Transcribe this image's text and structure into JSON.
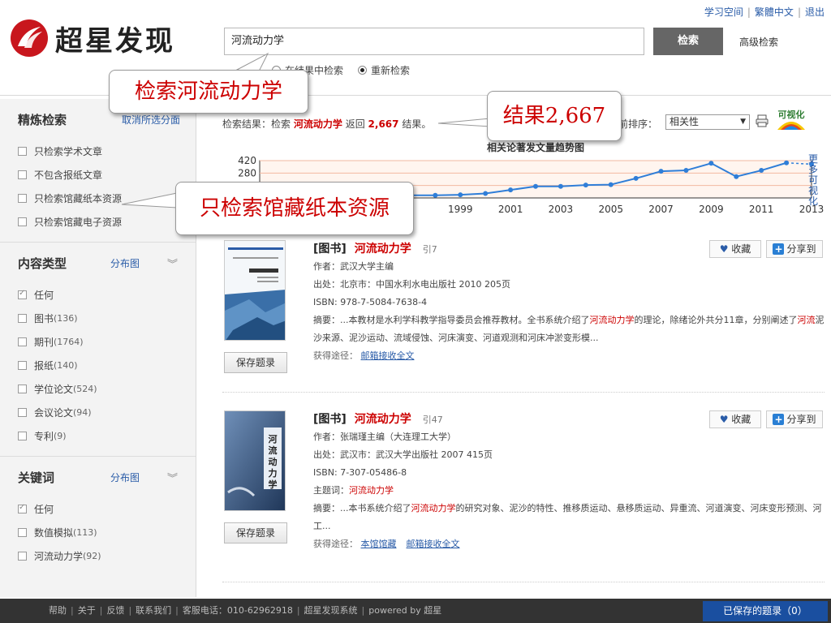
{
  "header": {
    "top_links": [
      "学习空间",
      "繁體中文",
      "退出"
    ],
    "logo_text": "超星发现",
    "search_value": "河流动力学",
    "search_button": "检索",
    "advanced_search": "高级检索",
    "search_option_1": "在结果中检索",
    "search_option_2": "重新检索"
  },
  "sidebar": {
    "refine": {
      "title": "精炼检索",
      "link": "取消所选分面",
      "items": [
        "只检索学术文章",
        "不包含报纸文章",
        "只检索馆藏纸本资源",
        "只检索馆藏电子资源"
      ]
    },
    "content_type": {
      "title": "内容类型",
      "link": "分布图",
      "items": [
        {
          "label": "任何",
          "count": ""
        },
        {
          "label": "图书",
          "count": "(136)"
        },
        {
          "label": "期刊",
          "count": "(1764)"
        },
        {
          "label": "报纸",
          "count": "(140)"
        },
        {
          "label": "学位论文",
          "count": "(524)"
        },
        {
          "label": "会议论文",
          "count": "(94)"
        },
        {
          "label": "专利",
          "count": "(9)"
        }
      ]
    },
    "keywords": {
      "title": "关键词",
      "link": "分布图",
      "items": [
        {
          "label": "任何",
          "count": ""
        },
        {
          "label": "数值模拟",
          "count": "(113)"
        },
        {
          "label": "河流动力学",
          "count": "(92)"
        }
      ]
    }
  },
  "main": {
    "result_prefix": "检索结果：检索",
    "result_keyword": "河流动力学",
    "result_mid": "返回",
    "result_count": "2,667",
    "result_suffix": "结果。",
    "sort_label": "前排序：",
    "sort_value": "相关性",
    "more_viz": "更多可视化"
  },
  "chart_data": {
    "type": "line",
    "title": "相关论著发文量趋势图",
    "x": [
      1991,
      1992,
      1993,
      1994,
      1995,
      1996,
      1997,
      1998,
      1999,
      2000,
      2001,
      2002,
      2003,
      2004,
      2005,
      2006,
      2007,
      2008,
      2009,
      2010,
      2011,
      2012,
      2013
    ],
    "values": [
      30,
      30,
      30,
      30,
      30,
      30,
      30,
      30,
      35,
      50,
      90,
      130,
      130,
      145,
      150,
      220,
      300,
      310,
      390,
      240,
      310,
      395,
      380
    ],
    "projected_from_index": 21,
    "ylim": [
      0,
      420
    ],
    "y_ticks": [
      420,
      280
    ],
    "x_tick_labels": [
      "1999",
      "2001",
      "2003",
      "2005",
      "2007",
      "2009",
      "2011",
      "2013"
    ],
    "color": "#2f7ed8"
  },
  "records": [
    {
      "type": "[图书]",
      "title": "河流动力学",
      "cite": "引7",
      "author": "作者：武汉大学主编",
      "source": "出处：北京市：中国水利水电出版社 2010 205页",
      "isbn": "ISBN: 978-7-5084-7638-4",
      "abs_a": "摘要：...本教材是水利学科教学指导委员会推荐教材。全书系统介绍了",
      "abs_hl1": "河流动力学",
      "abs_b": "的理论，除绪论外共分11章，分别阐述了",
      "abs_hl2": "河流",
      "abs_c": "泥沙来源、泥沙运动、流域侵蚀、河床演变、河道观测和河床冲淤变形模...",
      "access_label": "获得途径：",
      "links": [
        "邮箱接收全文"
      ],
      "save": "保存题录",
      "fav": "收藏",
      "share": "分享到"
    },
    {
      "type": "[图书]",
      "title": "河流动力学",
      "cite": "引47",
      "author": "作者：张瑞瑾主编（大连理工大学）",
      "source": "出处：武汉市：武汉大学出版社 2007 415页",
      "isbn": "ISBN: 7-307-05486-8",
      "subject_label": "主题词：",
      "subject": "河流动力学",
      "abs_a": "摘要：...本书系统介绍了",
      "abs_hl1": "河流动力学",
      "abs_b": "的研究对象、泥沙的特性、推移质运动、悬移质运动、异重流、河道演变、河床变形预测、河工...",
      "access_label": "获得途径：",
      "links": [
        "本馆馆藏",
        "邮箱接收全文"
      ],
      "save": "保存题录",
      "fav": "收藏",
      "share": "分享到"
    }
  ],
  "footer": {
    "links": [
      "帮助",
      "关于",
      "反馈",
      "联系我们",
      "客服电话：010-62962918",
      "超星发现系统",
      "powered by 超星"
    ],
    "saved": "已保存的题录（0）"
  },
  "callouts": {
    "search": "检索河流动力学",
    "result": "结果2,667",
    "paper": "只检索馆藏纸本资源"
  }
}
